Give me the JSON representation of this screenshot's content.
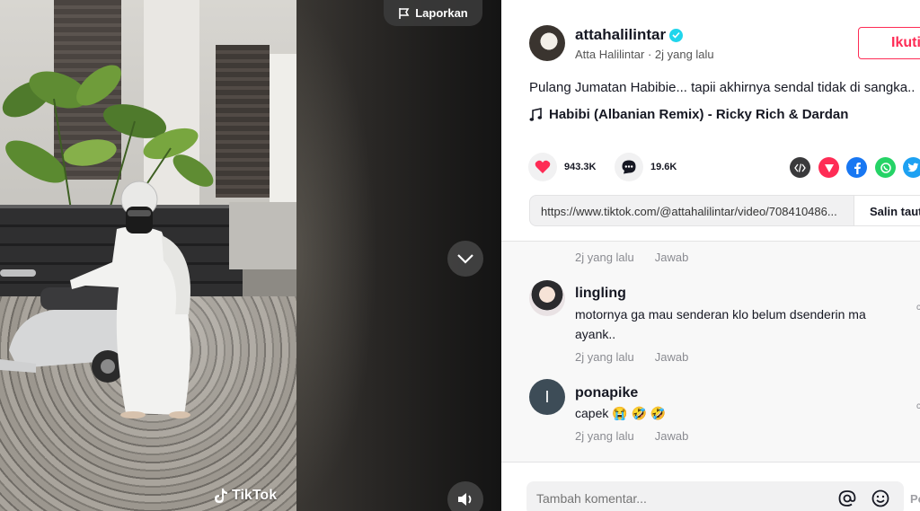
{
  "video": {
    "report_label": "Laporkan",
    "watermark": "TikTok"
  },
  "author": {
    "username": "attahalilintar",
    "display_name": "Atta Halilintar",
    "time_ago": "2j yang lalu",
    "follow_label": "Ikuti"
  },
  "post": {
    "caption": "Pulang Jumatan Habibie... tapii akhirnya sendal tidak di sangka..",
    "music": "Habibi (Albanian Remix) - Ricky Rich & Dardan"
  },
  "stats": {
    "likes": "943.3K",
    "comments": "19.6K"
  },
  "share_icons": [
    "embed-icon",
    "send-icon",
    "facebook-icon",
    "whatsapp-icon",
    "twitter-icon"
  ],
  "link": {
    "url": "https://www.tiktok.com/@attahalilintar/video/708410486...",
    "copy_label": "Salin taut"
  },
  "comments": [
    {
      "meta_time": "2j yang lalu",
      "reply_label": "Jawab"
    },
    {
      "name": "lingling",
      "text": "motornya ga mau senderan klo belum dsenderin ma ayank..",
      "time": "2j yang lalu",
      "reply_label": "Jawab"
    },
    {
      "name": "ponapike",
      "avatar_letter": "I",
      "text": "capek 😭 🤣 🤣",
      "time": "2j yang lalu",
      "reply_label": "Jawab"
    }
  ],
  "comment_input": {
    "placeholder": "Tambah komentar...",
    "post_label": "Posting"
  },
  "colors": {
    "accent": "#fe2c55",
    "verified": "#20d5ec",
    "facebook": "#1877f2",
    "whatsapp": "#25d366",
    "twitter": "#1da1f2"
  }
}
